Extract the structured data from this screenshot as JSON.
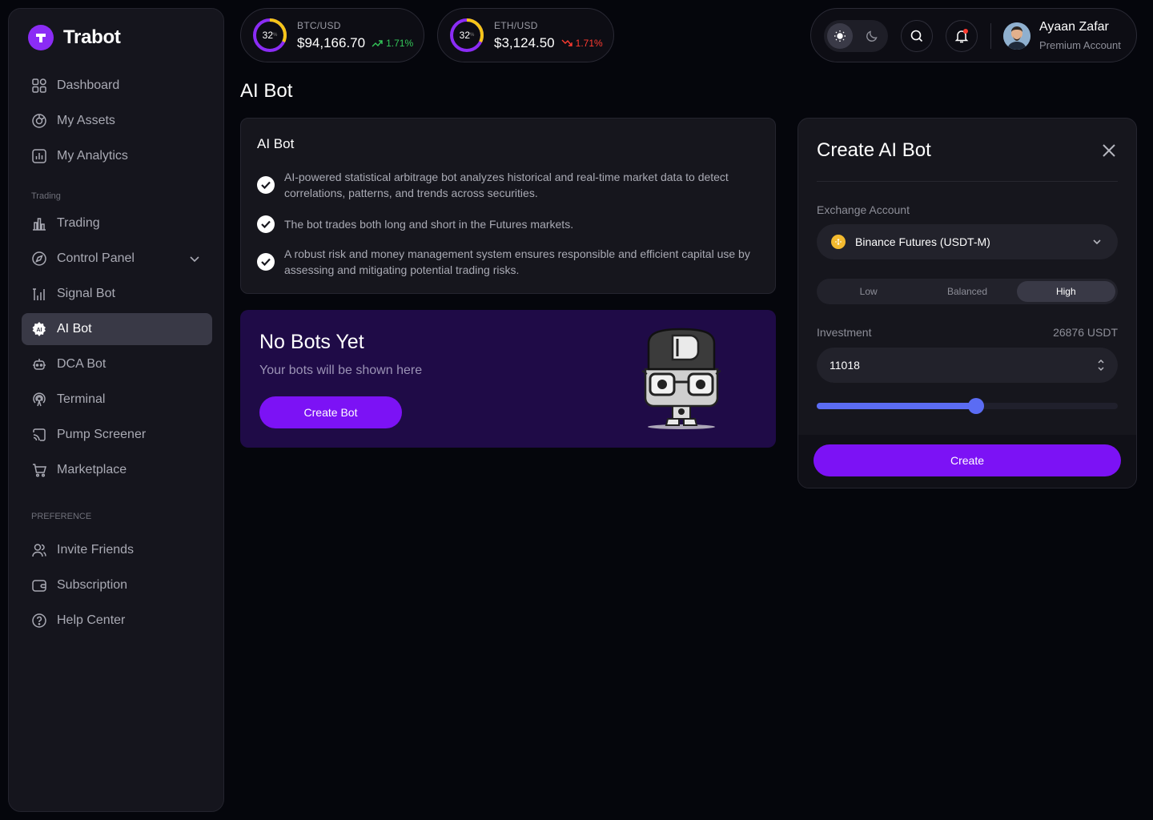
{
  "brand": {
    "name": "Trabot"
  },
  "sidebar": {
    "items": [
      {
        "label": "Dashboard"
      },
      {
        "label": "My Assets"
      },
      {
        "label": "My Analytics"
      }
    ],
    "section_trading": "Trading",
    "trading_items": [
      {
        "label": "Trading"
      },
      {
        "label": "Control Panel"
      },
      {
        "label": "Signal Bot"
      },
      {
        "label": "AI Bot"
      },
      {
        "label": "DCA Bot"
      },
      {
        "label": "Terminal"
      },
      {
        "label": "Pump Screener"
      },
      {
        "label": "Marketplace"
      }
    ],
    "section_preference": "PREFERENCE",
    "preference_items": [
      {
        "label": "Invite Friends"
      },
      {
        "label": "Subscription"
      },
      {
        "label": "Help Center"
      }
    ],
    "active": "AI Bot"
  },
  "tickers": [
    {
      "pair": "BTC/USD",
      "price": "$94,166.70",
      "change": "1.71%",
      "direction": "up",
      "gauge": "32",
      "gauge_pct": 0.32
    },
    {
      "pair": "ETH/USD",
      "price": "$3,124.50",
      "change": "1.71%",
      "direction": "down",
      "gauge": "32",
      "gauge_pct": 0.32
    }
  ],
  "user": {
    "name": "Ayaan Zafar",
    "plan": "Premium Account"
  },
  "page": {
    "title": "AI Bot"
  },
  "info_card": {
    "title": "AI Bot",
    "features": [
      "AI-powered statistical arbitrage bot analyzes historical and real-time market data to detect correlations, patterns, and trends across securities.",
      "The bot trades both long and short in the Futures markets.",
      "A robust risk and money management system ensures responsible and efficient capital use by assessing and mitigating potential trading risks."
    ]
  },
  "empty_state": {
    "title": "No Bots Yet",
    "subtitle": "Your bots will be shown here",
    "button": "Create Bot"
  },
  "create_panel": {
    "title": "Create AI Bot",
    "exchange_label": "Exchange Account",
    "exchange_value": "Binance Futures (USDT-M)",
    "risk_options": [
      "Low",
      "Balanced",
      "High"
    ],
    "risk_selected": "High",
    "investment_label": "Investment",
    "investment_available": "26876 USDT",
    "investment_value": "11018",
    "slider_fraction": 0.53,
    "button": "Create"
  },
  "colors": {
    "accent": "#7c12f5",
    "slider": "#5b6cf3",
    "up": "#34c759",
    "down": "#ff3b30",
    "empty_card_bg": "#1f0b47"
  }
}
